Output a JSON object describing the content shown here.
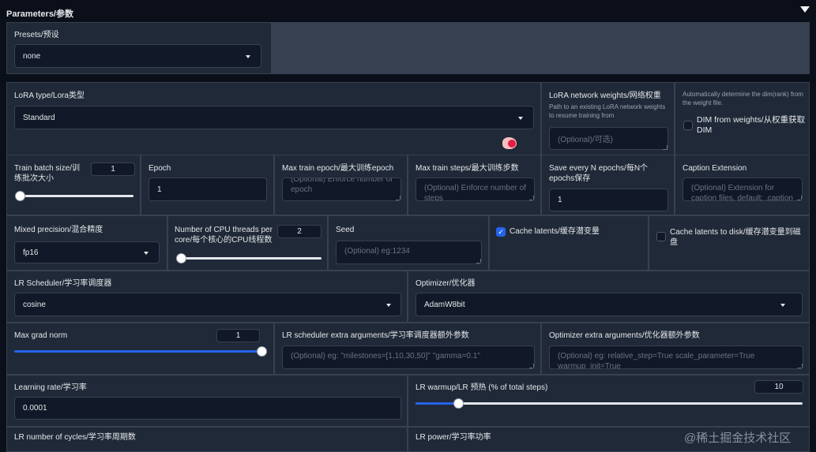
{
  "header": {
    "title": "Parameters/参数"
  },
  "presets": {
    "label": "Presets/预设",
    "value": "none"
  },
  "lora_type": {
    "label": "LoRA type/Lora类型",
    "value": "Standard"
  },
  "network_weights": {
    "label": "LoRA network weights/网络权重",
    "info": "Path to an existing LoRA network weights to resume training from",
    "placeholder": "(Optional)/可选)"
  },
  "dim_from_weights": {
    "info": "Automatically determine the dim(rank) from the weight file.",
    "label": "DIM from weights/从权重获取DIM",
    "checked": false
  },
  "train_batch": {
    "label": "Train batch size/训练批次大小",
    "value": "1",
    "fraction": 0.0
  },
  "epoch": {
    "label": "Epoch",
    "value": "1"
  },
  "max_train_epoch": {
    "label": "Max train epoch/最大训练epoch",
    "placeholder": "(Optional) Enforce number of epoch"
  },
  "max_train_steps": {
    "label": "Max train steps/最大训练步数",
    "placeholder": "(Optional) Enforce number of steps"
  },
  "save_every": {
    "label": "Save every N epochs/每N个epochs保存",
    "value": "1"
  },
  "caption_ext": {
    "label": "Caption Extension",
    "placeholder": "(Optional) Extension for caption files. default: .caption"
  },
  "mixed_precision": {
    "label": "Mixed precision/混合精度",
    "value": "fp16"
  },
  "cpu_threads": {
    "label": "Number of CPU threads per core/每个核心的CPU线程数",
    "value": "2",
    "fraction": 0.0
  },
  "seed": {
    "label": "Seed",
    "placeholder": "(Optional) eg:1234"
  },
  "cache_latents": {
    "label": "Cache latents/缓存潜变量",
    "checked": true
  },
  "cache_latents_disk": {
    "label": "Cache latents to disk/缓存潜变量到磁盘",
    "checked": false
  },
  "lr_scheduler": {
    "label": "LR Scheduler/学习率调度器",
    "value": "cosine"
  },
  "optimizer": {
    "label": "Optimizer/优化器",
    "value": "AdamW8bit"
  },
  "max_grad_norm": {
    "label": "Max grad norm",
    "value": "1",
    "fraction": 1.0
  },
  "lr_sched_args": {
    "label": "LR scheduler extra arguments/学习率调度器额外参数",
    "placeholder": "(Optional) eg: \"milestones=[1,10,30,50]\" \"gamma=0.1\""
  },
  "optim_args": {
    "label": "Optimizer extra arguments/优化器额外参数",
    "placeholder": "(Optional) eg: relative_step=True scale_parameter=True warmup_init=True"
  },
  "learning_rate": {
    "label": "Learning rate/学习率",
    "value": "0.0001"
  },
  "lr_warmup": {
    "label": "LR warmup/LR 预热 (% of total steps)",
    "value": "10",
    "fraction": 0.1
  },
  "lr_cycles": {
    "label": "LR number of cycles/学习率周期数"
  },
  "lr_power": {
    "label": "LR power/学习率功率"
  },
  "watermark": "@稀土掘金技术社区",
  "colors": {
    "accent": "#2563eb",
    "panel": "#1f2937",
    "background": "#0b0f19"
  }
}
